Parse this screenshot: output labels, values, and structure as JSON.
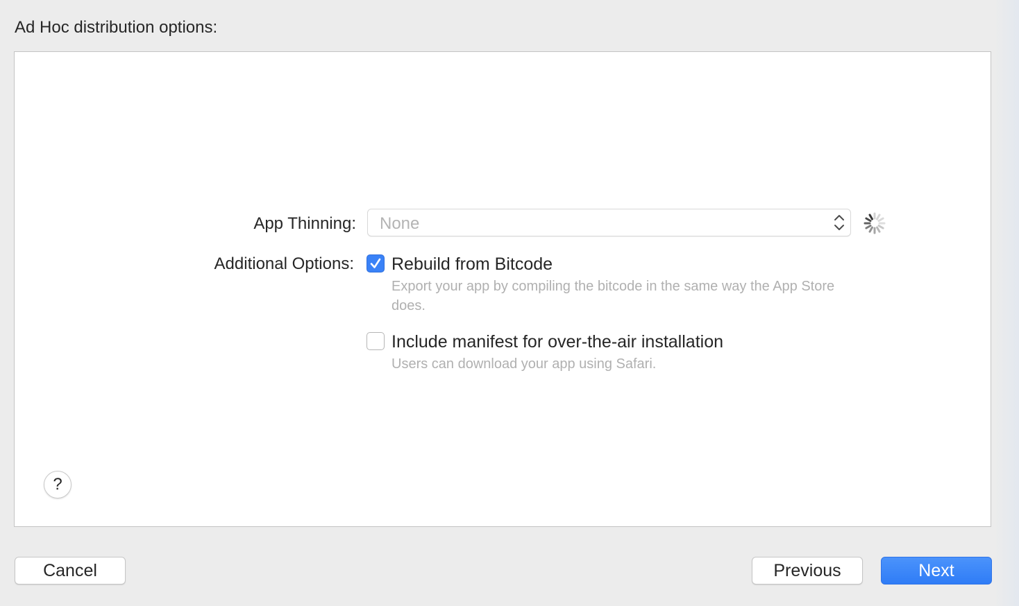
{
  "sheet": {
    "title": "Ad Hoc distribution options:"
  },
  "form": {
    "app_thinning_label": "App Thinning:",
    "app_thinning_value": "None",
    "additional_options_label": "Additional Options:",
    "options": [
      {
        "title": "Rebuild from Bitcode",
        "description": "Export your app by compiling the bitcode in the same way the App Store does.",
        "checked": true
      },
      {
        "title": "Include manifest for over-the-air installation",
        "description": "Users can download your app using Safari.",
        "checked": false
      }
    ]
  },
  "help": {
    "label": "?"
  },
  "buttons": {
    "cancel": "Cancel",
    "previous": "Previous",
    "next": "Next"
  },
  "colors": {
    "accent": "#3a82f7",
    "placeholder_text": "#b4b4b4",
    "background": "#ececec"
  },
  "icons": {
    "popup": "chevron-up-down-icon",
    "spinner": "loading-spinner-icon",
    "checkmark": "checkmark-icon"
  }
}
